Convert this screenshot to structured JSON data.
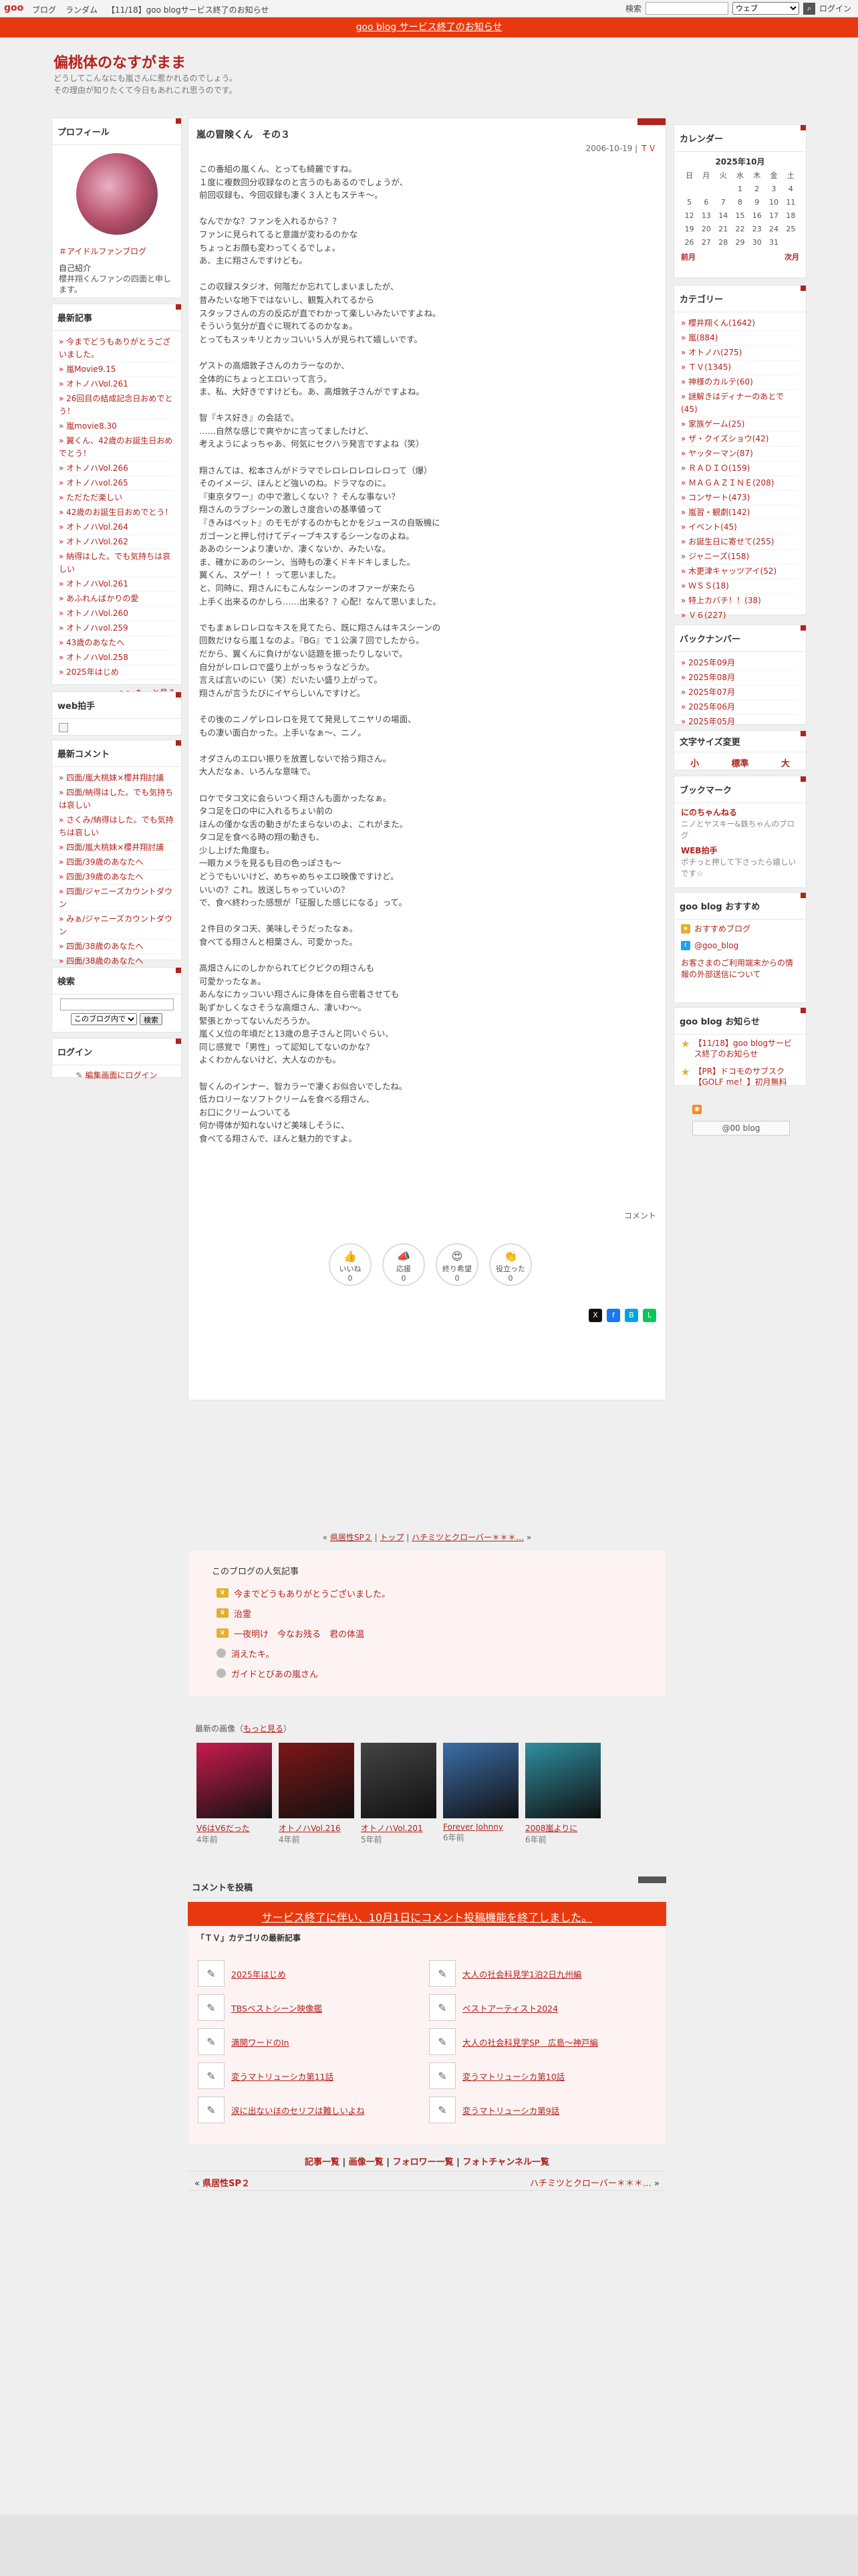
{
  "topbar": {
    "logo": "goo",
    "nav": [
      "ブログ",
      "ランダム",
      "【11/18】goo blogサービス終了のお知らせ"
    ],
    "search_label": "検索",
    "search_placeholder": "",
    "search_scope": "ウェブ",
    "login": "ログイン"
  },
  "notice": "goo blog サービス終了のお知らせ",
  "blog": {
    "title": "偏桃体のなすがまま",
    "desc1": "どうしてこんなにも嵐さんに惹かれるのでしょう。",
    "desc2": "その理由が知りたくて今日もあれこれ思うのです。"
  },
  "left": {
    "profile": {
      "heading": "プロフィール",
      "link": "＃アイドルファンブログ",
      "intro_label": "自己紹介",
      "intro": "櫻井翔くんファンの四面と申します。"
    },
    "recent": {
      "heading": "最新記事",
      "items": [
        "今までどうもありがとうございました。",
        "嵐Movie9.15",
        "オトノハVol.261",
        "26回目の結成記念日おめでとう！",
        "嵐movie8.30",
        "翼くん、42歳のお誕生日おめでとう！",
        "オトノハVol.266",
        "オトノハvol.265",
        "ただただ楽しい",
        "42歳のお誕生日おめでとう！",
        "オトノハVol.264",
        "オトノハVol.262",
        "納得はした。でも気持ちは哀しい",
        "オトノハVol.261",
        "あふれんばかりの愛",
        "オトノハVol.260",
        "オトノハvol.259",
        "43歳のあなたへ",
        "オトノハVol.258",
        "2025年はじめ"
      ],
      "more": ">> もっと見る"
    },
    "webclap": {
      "heading": "web拍手",
      "img_label": "web拍手"
    },
    "comments": {
      "heading": "最新コメント",
      "items": [
        "四面/嵐大桃妹×櫻井翔討議",
        "四面/納得はした。でも気持ちは哀しい",
        "さくみ/納得はした。でも気持ちは哀しい",
        "四面/嵐大桃妹×櫻井翔討議",
        "四面/39歳のあなたへ",
        "四面/39歳のあなたへ",
        "四面/ジャニーズカウントダウン",
        "みぁ/ジャニーズカウントダウン",
        "四面/38歳のあなたへ",
        "四面/38歳のあなたへ"
      ]
    },
    "search": {
      "heading": "検索",
      "scope": "このブログ内で",
      "button": "検索"
    },
    "login": {
      "heading": "ログイン",
      "link": "編集画面にログイン"
    }
  },
  "entry": {
    "title": "嵐の冒険くん　その３",
    "date": "2006-10-19",
    "category": "ＴＶ",
    "body": "この番組の嵐くん、とっても綺麗ですね。\n１度に複数回分収録なのと言うのもあるのでしょうが、\n前回収録も、今回収録も凄く３人ともステキ〜。\n\nなんでかな？ファンを入れるから？？\nファンに見られてると意識が変わるのかな\nちょっとお顔も変わってくるでしょ。\nあ、主に翔さんですけども。\n\nこの収録スタジオ、何階だか忘れてしまいましたが、\n昔みたいな地下ではないし、観覧入れてるから\nスタッフさんの方の反応が直でわかって楽しいみたいですよね。\nそういう気分が直ぐに現れてるのかなぁ。\nとってもスッキリとカッコいい５人が見られて嬉しいです。\n\nゲストの高畑敦子さんのカラーなのか、\n全体的にちょっとエロいって言う。\nま、私、大好きですけども。あ、高畑敦子さんがですよね。\n\n智『キス好き』の会話で。\n……自然な感じで爽やかに言ってましたけど、\n考えようによっちゃあ、何気にセクハラ発言ですよね（笑）\n\n翔さんては、松本さんがドラマでレロレロレロレロって（爆）\nそのイメージ、ほんとど強いのね。ドラマなのに。\n『東京タワー』の中で激しくない？？そんな事ない？\n翔さんのラブシーンの激しさ度合いの基準値って\n『きみはペット』のモモがするのかもとかをジュースの自販機に\nガゴーンと押し付けてディープキスするシーンなのよね。\nああのシーンより凄いか、凄くないか、みたいな。\nま、確かにあのシーン、当時もの凄くドキドキしました。\n翼くん、スゲー！！って思いました。\nと、同時に、翔さんにもこんなシーンのオファーが来たら\n上手く出来るのかしら……出来る？？心配！なんて思いました。\n\nでもまぁレロレロなキスを見てたら、既に翔さんはキスシーンの\n回数だけなら嵐１なのよ。『BG』で１公演７回でしたから。\nだから、翼くんに負けがない話題を振ったりしないで。\n自分がレロレロで盛り上がっちゃうなどうか。\n言えば言いのにい（笑）だいたい盛り上がって。\n翔さんが言うたびにイヤらしいんですけど。\n\nその後のニノゲレロレロを見てて発見してニヤリの場面、\nもの凄い面白かった。上手いなぁ〜、ニノ。\n\nオダさんのエロい振りを放置しないで拾う翔さん。\n大人だなぁ、いろんな意味で。\n\nロケでタコ文に会らいつく翔さんも面かったなぁ。\nタコ足を口の中に入れるちょい前の\nほんの僅かな舌の動きがたまらないのよ、これがまた。\nタコ足を食べる時の翔の動きも、\n少し上げた角度も。\n一眼カメラを見るも目の色っぽさも〜\nどうでもいいけど、めちゃめちゃエロ映像ですけど。\nいいの？これ。放送しちゃっていいの？\nで、食べ終わった感想が「征服した感じになる」って。\n\n２件目のタコ天、美味しそうだったなぁ。\n食べてる翔さんと相葉さん、可愛かった。\n\n高畑さんにのしかかられてビクビクの翔さんも\n可愛かったなぁ。\nあんなにカッコいい翔さんに身体を自ら密着させても\n恥ずかしくなさそうな高畑さん、凄いわ〜。\n緊張とかってないんだろうか。\n嵐く乂位の年頃だと13歳の息子さんと同いぐらい、\n同じ感覚で「男性」って認知してないのかな？\nよくわかんないけど、大人なのかも。\n\n智くんのインナー、智カラーで凄くお似合いでしたね。\n低カロリーなソフトクリームを食べる翔さん、\nお口にクリームついてる\n何か得体が知れないけど美味しそうに、\n食べてる翔さんで、ほんと魅力的ですよ。",
    "comment_link": "コメント",
    "reactions": [
      {
        "label": "いいね",
        "count": "0",
        "icon": "thumbs-up-icon"
      },
      {
        "label": "応援",
        "count": "0",
        "icon": "megaphone-icon"
      },
      {
        "label": "終り希望",
        "count": "0",
        "icon": "heart-eyes-icon"
      },
      {
        "label": "役立った",
        "count": "0",
        "icon": "clap-icon"
      }
    ]
  },
  "pager": {
    "prev": "県居性SP２",
    "top": "トップ",
    "next": "ハチミツとクローバー＊＊＊…"
  },
  "popular": {
    "heading": "このブログの人気記事",
    "items": [
      "今までどうもありがとうございました。",
      "治霊",
      "一夜明け　今なお残る　君の体温",
      "消えたキ。",
      "ガイドとびあの嵐さん"
    ]
  },
  "recent_images": {
    "caption": "最新の画像",
    "more": "もっと見る",
    "items": [
      {
        "title": "V6はV6だった",
        "date": "4年前",
        "color": "#c71b4d"
      },
      {
        "title": "オトノハVol.216",
        "date": "4年前",
        "color": "#7e1616"
      },
      {
        "title": "オトノハVol.201",
        "date": "5年前",
        "color": "#444444"
      },
      {
        "title": "Forever Johnny",
        "date": "6年前",
        "color": "#3b6ea8"
      },
      {
        "title": "2008嵐よりに",
        "date": "6年前",
        "color": "#2f8fa0"
      }
    ]
  },
  "comment_section": {
    "heading": "コメントを投稿",
    "closed": "サービス終了に伴い、10月1日にコメント投稿機能を終了しました。"
  },
  "category_recent": {
    "heading": "「ＴＶ」カテゴリの最新記事",
    "items": [
      "2025年はじめ",
      "大人の社会科見学1泊2日九州編",
      "TBSベストシーン映像鑑",
      "ベストアーティスト2024",
      "満開ワードのIn",
      "大人の社会科見学SP　広島〜神戸編",
      "変うマトリューシカ第11話",
      "変うマトリューシカ第10話",
      "涙に出ないほのセリフは難しいよね",
      "変うマトリューシカ第9話"
    ]
  },
  "bottom_links": {
    "a": "記事一覧",
    "b": "画像一覧",
    "c": "フォロワー一覧",
    "d": "フォトチャンネル一覧"
  },
  "bottom_nav": {
    "prev": "県居性SP２",
    "next": "ハチミツとクローバー＊＊＊…"
  },
  "right": {
    "calendar": {
      "heading": "カレンダー",
      "month": "2025年10月",
      "weekdays": [
        "日",
        "月",
        "火",
        "水",
        "木",
        "金",
        "土"
      ],
      "weeks": [
        [
          "",
          "",
          "",
          "1",
          "2",
          "3",
          "4"
        ],
        [
          "5",
          "6",
          "7",
          "8",
          "9",
          "10",
          "11"
        ],
        [
          "12",
          "13",
          "14",
          "15",
          "16",
          "17",
          "18"
        ],
        [
          "19",
          "20",
          "21",
          "22",
          "23",
          "24",
          "25"
        ],
        [
          "26",
          "27",
          "28",
          "29",
          "30",
          "31",
          ""
        ]
      ],
      "prev": "前月",
      "next": "次月"
    },
    "categories": {
      "heading": "カテゴリー",
      "items": [
        "櫻井翔くん(1642)",
        "嵐(884)",
        "オトノハ(275)",
        "ＴＶ(1345)",
        "神様のカルテ(60)",
        "謎解きはディナーのあとで(45)",
        "家族ゲーム(25)",
        "ザ・クイズショウ(42)",
        "ヤッターマン(87)",
        "ＲＡＤＩＯ(159)",
        "ＭＡＧＡＺＩＮＥ(208)",
        "コンサート(473)",
        "嵐習・観劇(142)",
        "イベント(45)",
        "お誕生日に寄せて(255)",
        "ジャニーズ(158)",
        "木更津キャッツアイ(52)",
        "ＷＳＳ(18)",
        "特上カバチ！！(38)",
        "Ｖ６(227)"
      ]
    },
    "backnumber": {
      "heading": "バックナンバー",
      "items": [
        "2025年09月",
        "2025年08月",
        "2025年07月",
        "2025年06月",
        "2025年05月"
      ]
    },
    "fontsize": {
      "heading": "文字サイズ変更",
      "s": "小",
      "m": "標準",
      "l": "大"
    },
    "bookmark": {
      "heading": "ブックマーク",
      "a_title": "にのちゃんねる",
      "a_desc": "ニノとヤスキー&鉄ちゃんのブログ",
      "b_title": "WEB拍手",
      "b_desc": "ポチっと押して下さったら嬉しいです☆"
    },
    "goo_recommend": {
      "heading": "goo blog おすすめ",
      "a": "おすすめブログ",
      "b": "@goo_blog",
      "notice": "お客さまのご利用端末からの情報の外部送信について"
    },
    "goo_news": {
      "heading": "goo blog お知らせ",
      "a": "【11/18】goo blogサービス終了のお知らせ",
      "b": "【PR】ドコモのサブスク【GOLF me！】初月無料"
    },
    "footer_logo": "@00 blog"
  },
  "colors": {
    "accent": "#b3221b",
    "banner": "#e8390e"
  }
}
